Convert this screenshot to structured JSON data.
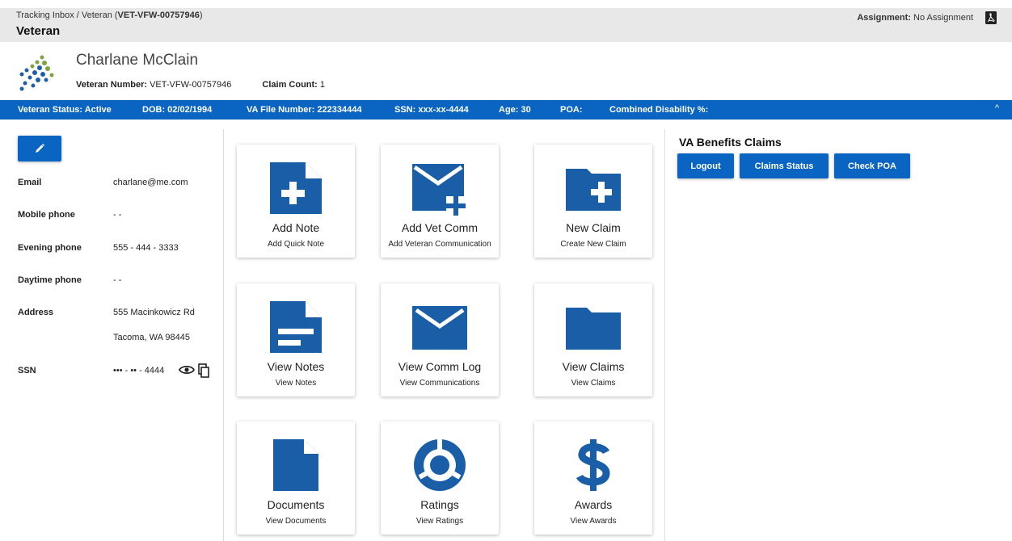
{
  "breadcrumb": {
    "prefix": "Tracking Inbox / Veteran (",
    "id": "VET-VFW-00757946",
    "suffix": ")"
  },
  "page_title": "Veteran",
  "assignment": {
    "label": "Assignment:",
    "value": "No Assignment",
    "icon": "pdf-icon"
  },
  "veteran": {
    "name": "Charlane McClain",
    "number_label": "Veteran Number:",
    "number_value": "VET-VFW-00757946",
    "claim_count_label": "Claim Count:",
    "claim_count_value": "1"
  },
  "status_bar": {
    "status": "Veteran Status: Active",
    "dob": "DOB: 02/02/1994",
    "va_file": "VA File Number: 222334444",
    "ssn": "SSN: xxx-xx-4444",
    "age": "Age: 30",
    "poa": "POA:",
    "disability": "Combined Disability %:",
    "toggle": "^"
  },
  "contact": {
    "email_label": "Email",
    "email_value": "charlane@me.com",
    "mobile_label": "Mobile phone",
    "mobile_value": "- -",
    "evening_label": "Evening phone",
    "evening_value": "555 - 444 - 3333",
    "daytime_label": "Daytime phone",
    "daytime_value": "- -",
    "address_label": "Address",
    "address_line1": "555 Macinkowicz Rd",
    "address_line2": "Tacoma, WA 98445",
    "ssn_label": "SSN",
    "ssn_value": "••• - •• - 4444"
  },
  "tiles": [
    {
      "title": "Add Note",
      "subtitle": "Add Quick Note",
      "icon": "add-note-icon"
    },
    {
      "title": "Add Vet Comm",
      "subtitle": "Add Veteran Communication",
      "icon": "add-mail-icon"
    },
    {
      "title": "New Claim",
      "subtitle": "Create New Claim",
      "icon": "new-folder-icon"
    },
    {
      "title": "View Notes",
      "subtitle": "View Notes",
      "icon": "notes-icon"
    },
    {
      "title": "View Comm Log",
      "subtitle": "View Communications",
      "icon": "mail-icon"
    },
    {
      "title": "View Claims",
      "subtitle": "View Claims",
      "icon": "folder-icon"
    },
    {
      "title": "Documents",
      "subtitle": "View Documents",
      "icon": "document-icon"
    },
    {
      "title": "Ratings",
      "subtitle": "View Ratings",
      "icon": "ratings-icon"
    },
    {
      "title": "Awards",
      "subtitle": "View Awards",
      "icon": "dollar-icon"
    }
  ],
  "claims_panel": {
    "title": "VA Benefits Claims",
    "buttons": [
      "Logout",
      "Claims Status",
      "Check POA"
    ]
  },
  "colors": {
    "primary": "#0a65c2",
    "tile_icon": "#1a5ea8",
    "logo_green": "#7da43d",
    "logo_blue": "#1f5fa6"
  }
}
